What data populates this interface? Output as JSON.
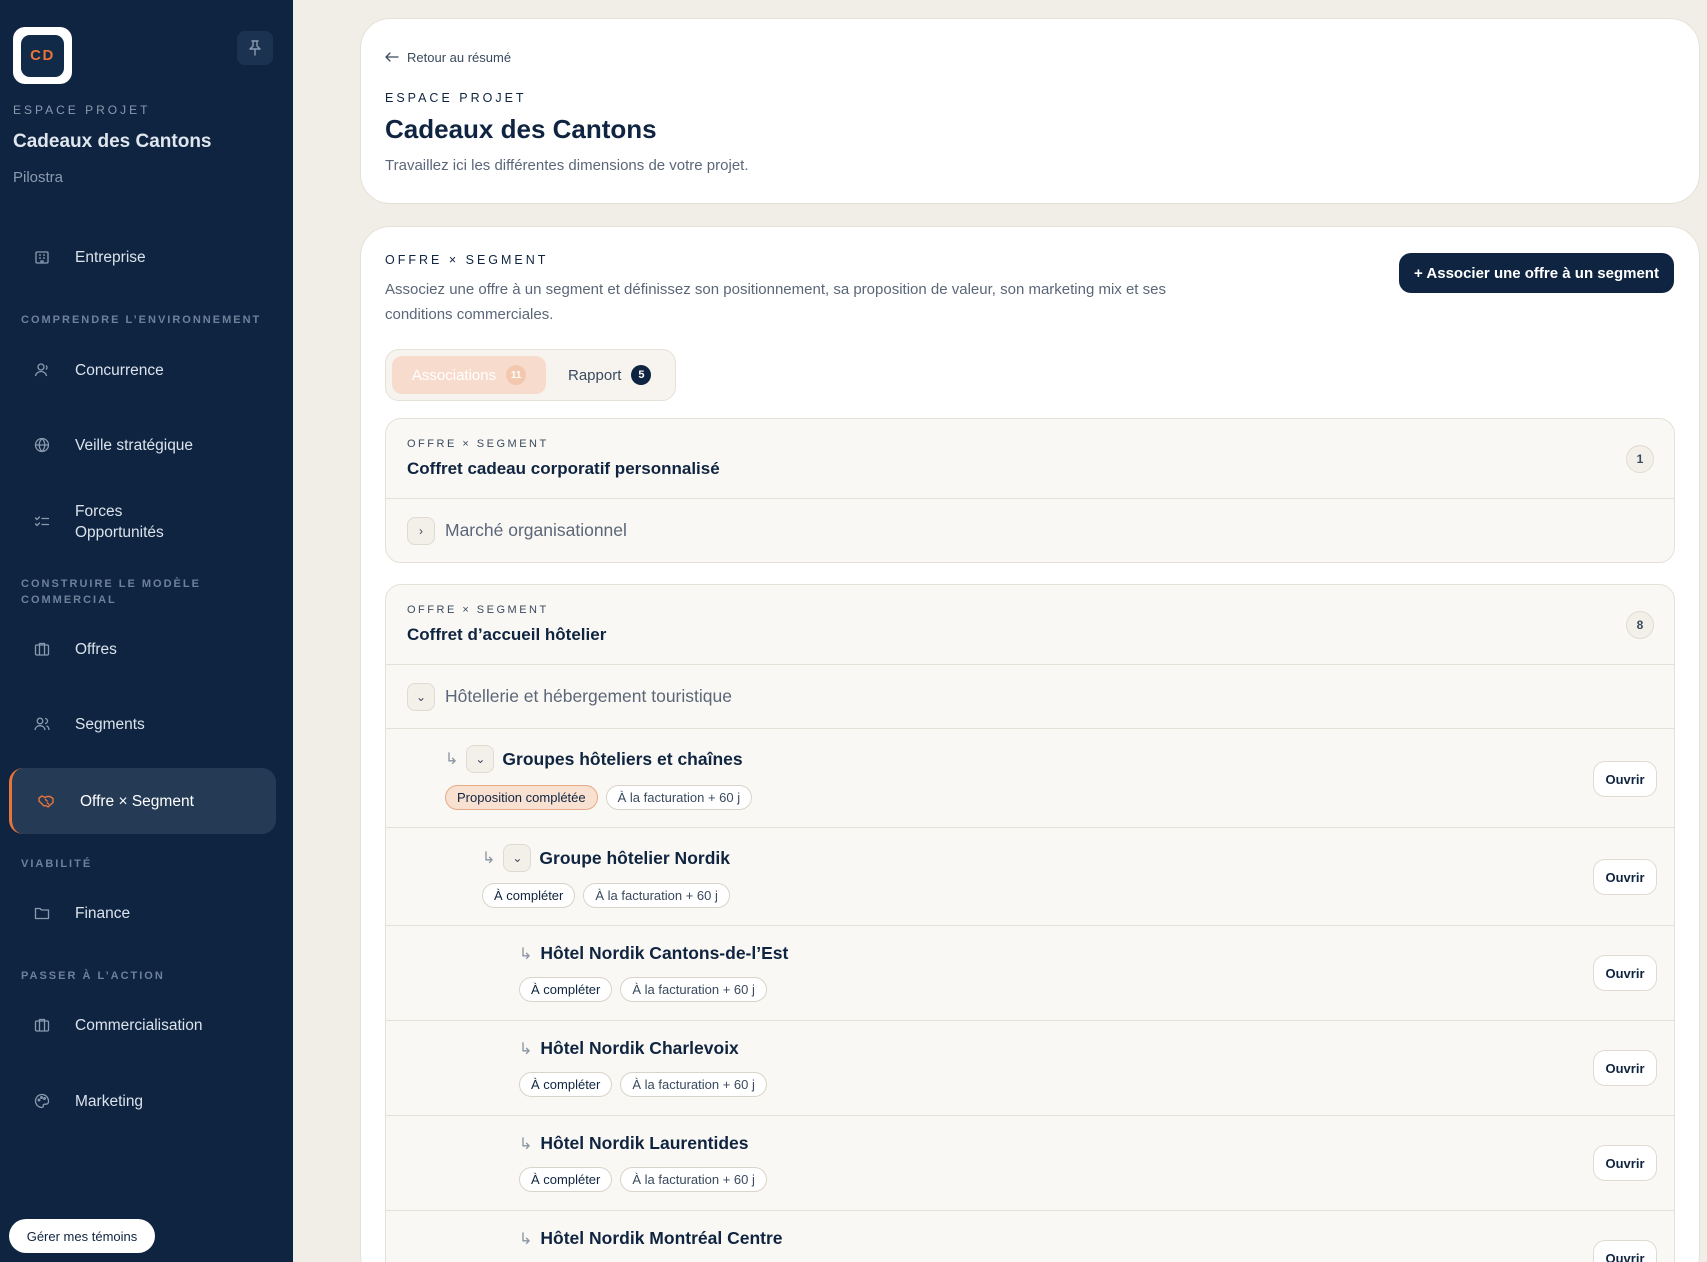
{
  "sidebar": {
    "logo_text": "CD",
    "eyebrow": "ESPACE PROJET",
    "project_name": "Cadeaux des Cantons",
    "company": "Pilostra",
    "items": [
      {
        "label": "Entreprise"
      },
      {
        "label": "Concurrence"
      },
      {
        "label": "Veille stratégique"
      },
      {
        "label": "Forces Opportunités"
      },
      {
        "label": "Offres"
      },
      {
        "label": "Segments"
      },
      {
        "label": "Offre × Segment"
      },
      {
        "label": "Finance"
      },
      {
        "label": "Commercialisation"
      },
      {
        "label": "Marketing"
      }
    ],
    "sections": [
      "COMPRENDRE L’ENVIRONNEMENT",
      "CONSTRUIRE LE MODÈLE COMMERCIAL",
      "VIABILITÉ",
      "PASSER À L’ACTION"
    ],
    "cookie_button": "Gérer mes témoins"
  },
  "header": {
    "back_label": "Retour au résumé",
    "eyebrow": "ESPACE PROJET",
    "title": "Cadeaux des Cantons",
    "description": "Travaillez ici les différentes dimensions de votre projet."
  },
  "main": {
    "eyebrow": "OFFRE × SEGMENT",
    "description": "Associez une offre à un segment et définissez son positionnement, sa proposition de valeur, son marketing mix et ses conditions commerciales.",
    "primary_button": "+ Associer une offre à un segment",
    "tabs": [
      {
        "label": "Associations",
        "count": "11"
      },
      {
        "label": "Rapport",
        "count": "5"
      }
    ],
    "groups": [
      {
        "eyebrow": "OFFRE × SEGMENT",
        "title": "Coffret cadeau corporatif personnalisé",
        "count": "1",
        "segment": "Marché organisationnel",
        "segment_chevron": "›"
      },
      {
        "eyebrow": "OFFRE × SEGMENT",
        "title": "Coffret d’accueil hôtelier",
        "count": "8",
        "segment": "Hôtellerie et hébergement touristique",
        "segment_chevron": "⌄",
        "rows": [
          {
            "title": "Groupes hôteliers et chaînes",
            "status": "Proposition complétée",
            "terms": "À la facturation + 60 j",
            "open": "Ouvrir"
          },
          {
            "title": "Groupe hôtelier Nordik",
            "status": "À compléter",
            "terms": "À la facturation + 60 j",
            "open": "Ouvrir"
          },
          {
            "title": "Hôtel Nordik Cantons-de-l’Est",
            "status": "À compléter",
            "terms": "À la facturation + 60 j",
            "open": "Ouvrir"
          },
          {
            "title": "Hôtel Nordik Charlevoix",
            "status": "À compléter",
            "terms": "À la facturation + 60 j",
            "open": "Ouvrir"
          },
          {
            "title": "Hôtel Nordik Laurentides",
            "status": "À compléter",
            "terms": "À la facturation + 60 j",
            "open": "Ouvrir"
          },
          {
            "title": "Hôtel Nordik Montréal Centre",
            "open": "Ouvrir"
          }
        ]
      }
    ]
  },
  "colors": {
    "navy": "#0f2440",
    "accent": "#e8743b",
    "background": "#f1eee7"
  }
}
